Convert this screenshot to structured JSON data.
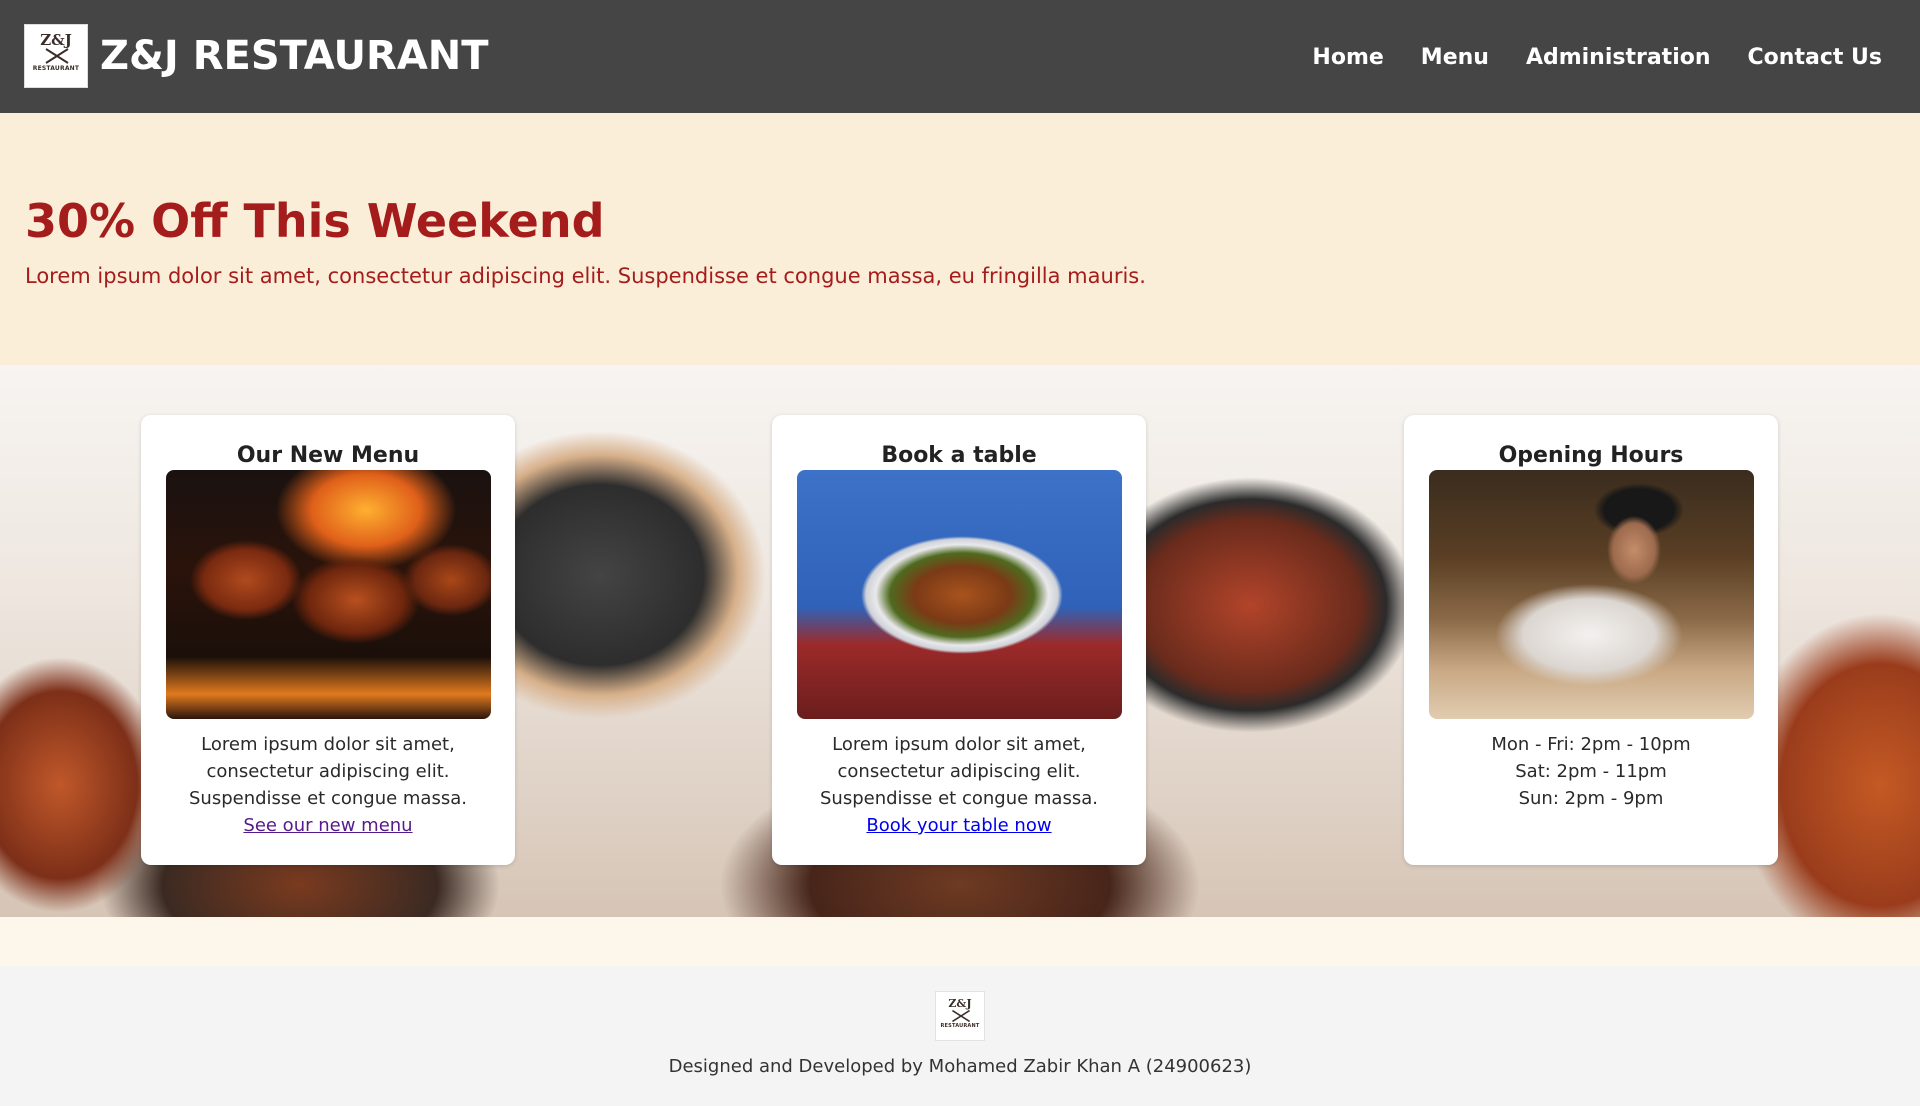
{
  "header": {
    "logo": {
      "text": "Z&J",
      "subtext": "RESTAURANT"
    },
    "brand": "Z&J RESTAURANT",
    "nav": [
      {
        "label": "Home"
      },
      {
        "label": "Menu"
      },
      {
        "label": "Administration"
      },
      {
        "label": "Contact Us"
      }
    ]
  },
  "promo": {
    "title": "30% Off This Weekend",
    "text": "Lorem ipsum dolor sit amet, consectetur adipiscing elit. Suspendisse et congue massa, eu fringilla mauris."
  },
  "cards": [
    {
      "title": "Our New Menu",
      "lines": [
        "Lorem ipsum dolor sit amet,",
        "consectetur adipiscing elit.",
        "Suspendisse et congue massa."
      ],
      "link": "See our new menu"
    },
    {
      "title": "Book a table",
      "lines": [
        "Lorem ipsum dolor sit amet,",
        "consectetur adipiscing elit.",
        "Suspendisse et congue massa."
      ],
      "link": "Book your table now"
    },
    {
      "title": "Opening Hours",
      "lines": [
        "Mon - Fri: 2pm - 10pm",
        "Sat: 2pm - 11pm",
        "Sun: 2pm - 9pm"
      ]
    }
  ],
  "footer": {
    "logo": {
      "text": "Z&J",
      "subtext": "RESTAURANT"
    },
    "credit": "Designed and Developed by Mohamed Zabir Khan A (24900623)"
  },
  "colors": {
    "header_bg": "#454545",
    "promo_bg": "#fbeed8",
    "accent_red": "#a51c1c",
    "footer_bg": "#f4f4f4"
  }
}
